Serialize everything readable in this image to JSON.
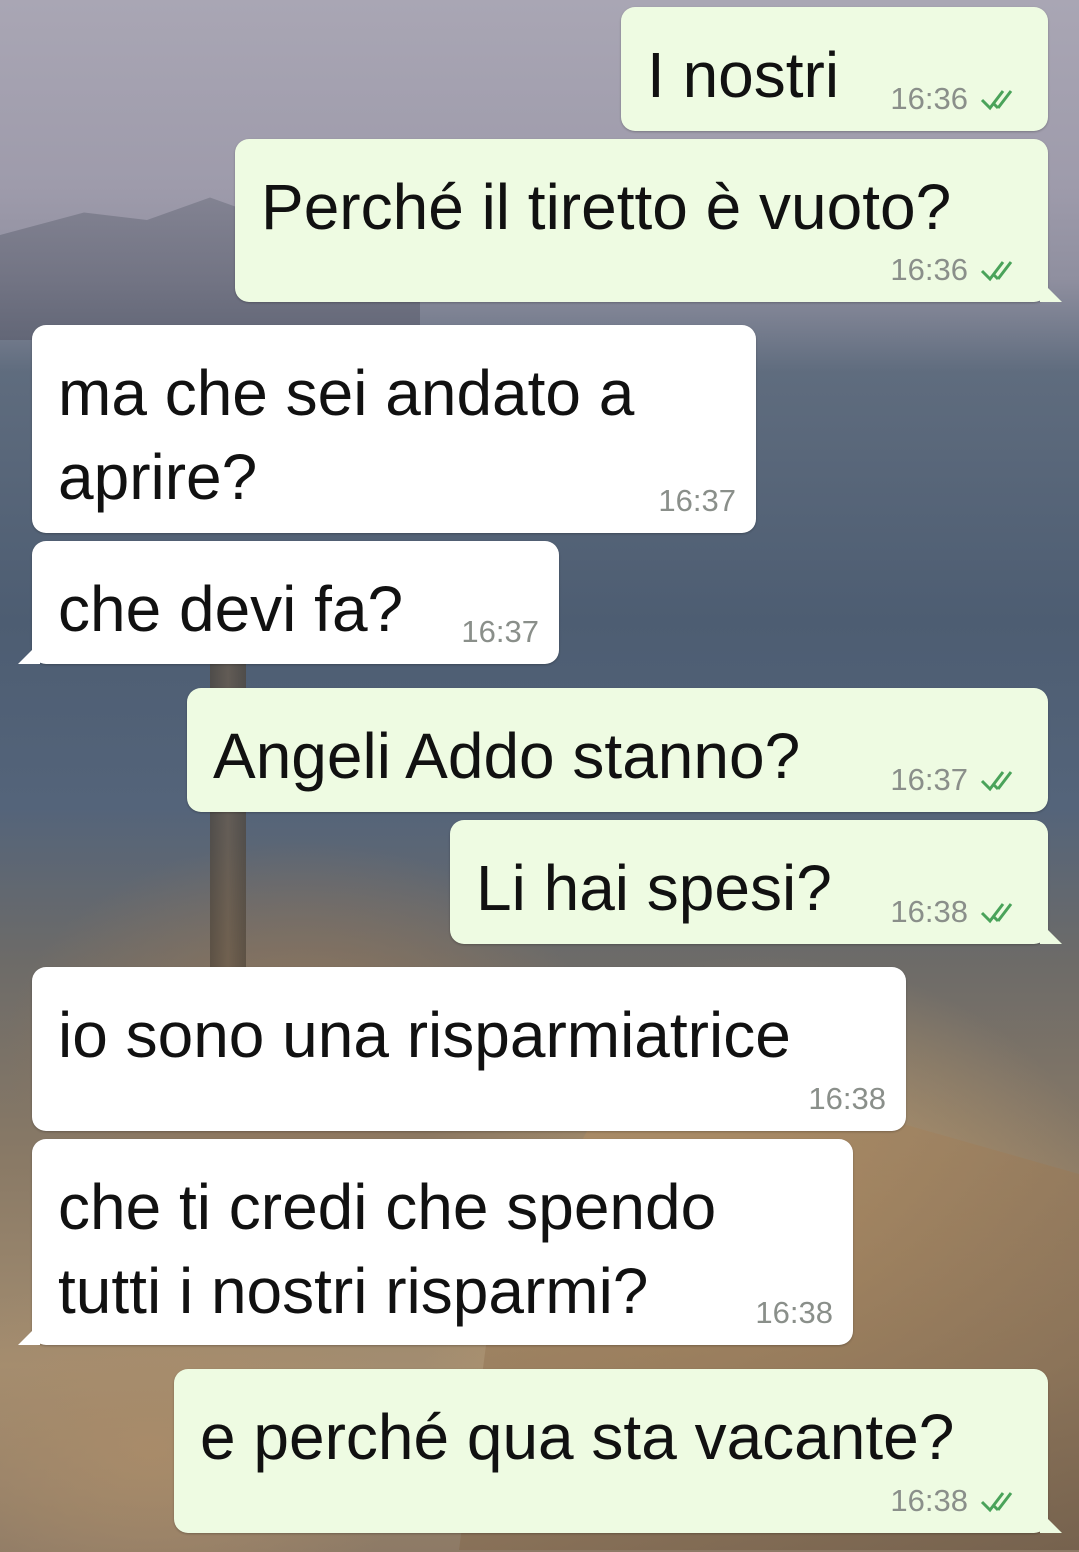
{
  "messages": [
    {
      "direction": "out",
      "text": "I nostri",
      "time": "16:36",
      "status_icon": "double-check-icon"
    },
    {
      "direction": "out",
      "text": "Perché il tiretto è vuoto?",
      "time": "16:36",
      "status_icon": "double-check-icon"
    },
    {
      "direction": "in",
      "text": "ma che sei andato a\naprire?",
      "time": "16:37"
    },
    {
      "direction": "in",
      "text": "che devi fa?",
      "time": "16:37"
    },
    {
      "direction": "out",
      "text": "Angeli Addo stanno?",
      "time": "16:37",
      "status_icon": "double-check-icon"
    },
    {
      "direction": "out",
      "text": "Li hai spesi?",
      "time": "16:38",
      "status_icon": "double-check-icon"
    },
    {
      "direction": "in",
      "text": "io sono una risparmiatrice",
      "time": "16:38"
    },
    {
      "direction": "in",
      "text": "che ti credi che spendo\ntutti i nostri risparmi?",
      "time": "16:38"
    },
    {
      "direction": "out",
      "text": "e perché qua sta vacante?",
      "time": "16:38",
      "status_icon": "double-check-icon"
    }
  ],
  "colors": {
    "outgoing_bubble": "#eefbe2",
    "incoming_bubble": "#ffffff",
    "tick_color": "#4aa35a",
    "timestamp_color": "#8a8f8a"
  }
}
